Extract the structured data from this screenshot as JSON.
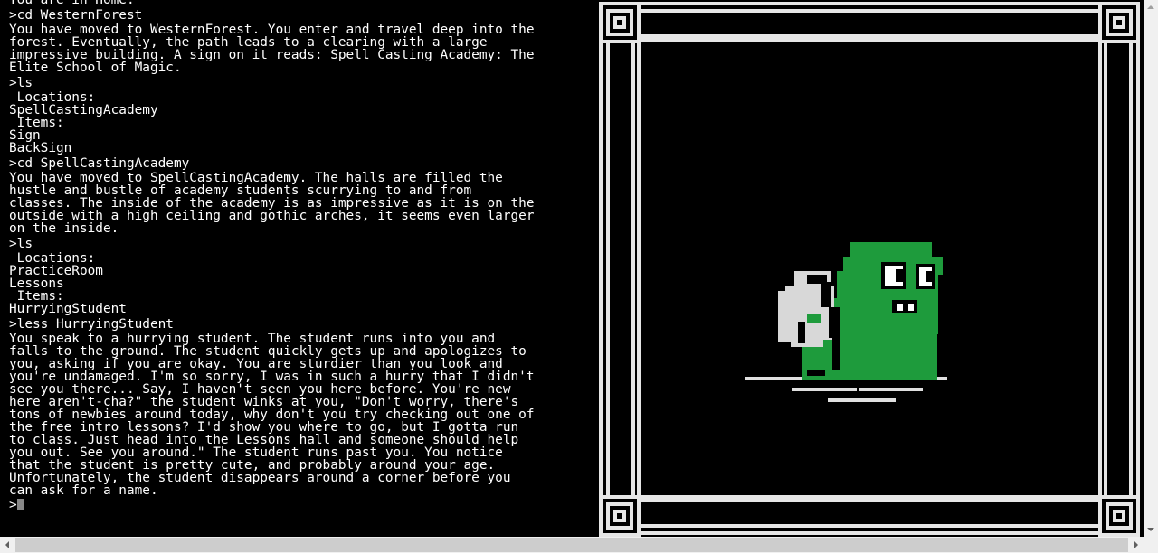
{
  "terminal": {
    "lines": [
      {
        "text": "You are in Home.",
        "kind": "out"
      },
      {
        "text": ">cd WesternForest",
        "kind": "cmd"
      },
      {
        "text": "You have moved to WesternForest. You enter and travel deep into the",
        "kind": "out"
      },
      {
        "text": "forest. Eventually, the path leads to a clearing with a large",
        "kind": "out"
      },
      {
        "text": "impressive building. A sign on it reads: Spell Casting Academy: The",
        "kind": "out"
      },
      {
        "text": "Elite School of Magic.",
        "kind": "out"
      },
      {
        "text": ">ls",
        "kind": "cmd"
      },
      {
        "text": " Locations:",
        "kind": "out"
      },
      {
        "text": "SpellCastingAcademy",
        "kind": "out"
      },
      {
        "text": " Items:",
        "kind": "out"
      },
      {
        "text": "Sign",
        "kind": "out"
      },
      {
        "text": "BackSign",
        "kind": "out"
      },
      {
        "text": ">cd SpellCastingAcademy",
        "kind": "cmd"
      },
      {
        "text": "You have moved to SpellCastingAcademy. The halls are filled the",
        "kind": "out"
      },
      {
        "text": "hustle and bustle of academy students scurrying to and from",
        "kind": "out"
      },
      {
        "text": "classes. The inside of the academy is as impressive as it is on the",
        "kind": "out"
      },
      {
        "text": "outside with a high ceiling and gothic arches, it seems even larger",
        "kind": "out"
      },
      {
        "text": "on the inside.",
        "kind": "out"
      },
      {
        "text": ">ls",
        "kind": "cmd"
      },
      {
        "text": " Locations:",
        "kind": "out"
      },
      {
        "text": "PracticeRoom",
        "kind": "out"
      },
      {
        "text": "Lessons",
        "kind": "out"
      },
      {
        "text": " Items:",
        "kind": "out"
      },
      {
        "text": "HurryingStudent",
        "kind": "out"
      },
      {
        "text": ">less HurryingStudent",
        "kind": "cmd"
      },
      {
        "text": "You speak to a hurrying student. The student runs into you and",
        "kind": "out"
      },
      {
        "text": "falls to the ground. The student quickly gets up and apologizes to",
        "kind": "out"
      },
      {
        "text": "you, asking if you are okay. You are sturdier than you look and",
        "kind": "out"
      },
      {
        "text": "you're undamaged. I'm so sorry, I was in such a hurry that I didn't",
        "kind": "out"
      },
      {
        "text": "see you there... Say, I haven't seen you here before. You're new",
        "kind": "out"
      },
      {
        "text": "here aren't-cha?\" the student winks at you, \"Don't worry, there's",
        "kind": "out"
      },
      {
        "text": "tons of newbies around today, why don't you try checking out one of",
        "kind": "out"
      },
      {
        "text": "the free intro lessons? I'd show you where to go, but I gotta run",
        "kind": "out"
      },
      {
        "text": "to class. Just head into the Lessons hall and someone should help",
        "kind": "out"
      },
      {
        "text": "you out. See you around.\" The student runs past you. You notice",
        "kind": "out"
      },
      {
        "text": "that the student is pretty cute, and probably around your age.",
        "kind": "out"
      },
      {
        "text": "Unfortunately, the student disappears around a corner before you",
        "kind": "out"
      },
      {
        "text": "can ask for a name.",
        "kind": "out"
      }
    ],
    "prompt": ">",
    "input_value": ""
  },
  "art": {
    "character": "hurrying-student",
    "colors": {
      "frame": "#e6e6e6",
      "body": "#1e9b3c",
      "bag": "#d8d8d8",
      "ink": "#000000",
      "ground": "#e0e0e0"
    }
  },
  "icons": {
    "scroll_up": "triangle-up-icon",
    "scroll_down": "triangle-down-icon",
    "scroll_left": "triangle-left-icon",
    "scroll_right": "triangle-right-icon"
  }
}
